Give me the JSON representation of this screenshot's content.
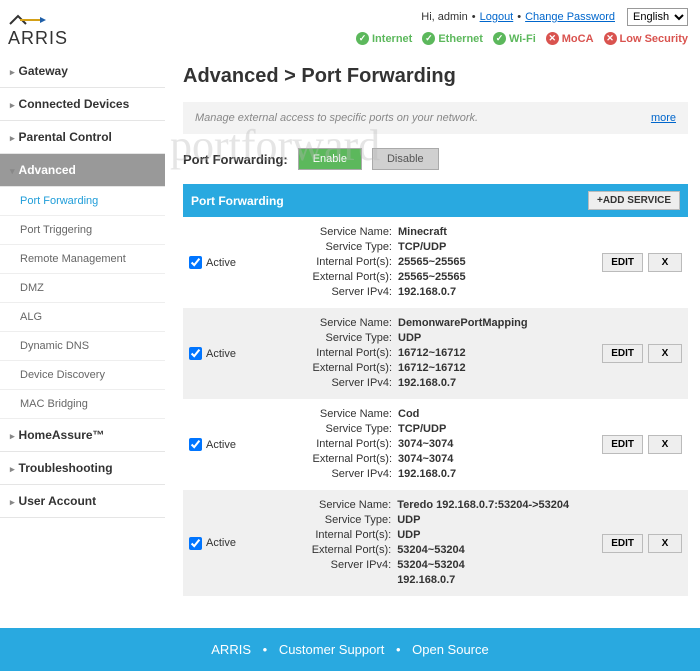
{
  "brand": "ARRIS",
  "header": {
    "greeting": "Hi, admin",
    "logout": "Logout",
    "change_pw": "Change Password",
    "lang_selected": "English"
  },
  "status": {
    "internet": {
      "label": "Internet",
      "ok": true
    },
    "ethernet": {
      "label": "Ethernet",
      "ok": true
    },
    "wifi": {
      "label": "Wi-Fi",
      "ok": true
    },
    "moca": {
      "label": "MoCA",
      "ok": false
    },
    "security": {
      "label": "Low Security",
      "ok": false
    }
  },
  "nav": {
    "gateway": "Gateway",
    "connected": "Connected Devices",
    "parental": "Parental Control",
    "advanced": "Advanced",
    "advanced_items": [
      "Port Forwarding",
      "Port Triggering",
      "Remote Management",
      "DMZ",
      "ALG",
      "Dynamic DNS",
      "Device Discovery",
      "MAC Bridging"
    ],
    "homeassure": "HomeAssure™",
    "troubleshooting": "Troubleshooting",
    "user_account": "User Account"
  },
  "page": {
    "title": "Advanced > Port Forwarding",
    "desc": "Manage external access to specific ports on your network.",
    "more": "more",
    "toggle_label": "Port Forwarding:",
    "enable": "Enable",
    "disable": "Disable",
    "panel_title": "Port Forwarding",
    "add": "+ADD SERVICE",
    "edit": "EDIT",
    "del": "X",
    "active": "Active",
    "field_labels": {
      "name": "Service Name:",
      "type": "Service Type:",
      "int": "Internal Port(s):",
      "ext": "External Port(s):",
      "ip": "Server IPv4:"
    }
  },
  "rules": [
    {
      "active": true,
      "name": "Minecraft",
      "type": "TCP/UDP",
      "int": "25565~25565",
      "ext": "25565~25565",
      "ip": "192.168.0.7"
    },
    {
      "active": true,
      "name": "DemonwarePortMapping",
      "type": "UDP",
      "int": "16712~16712",
      "ext": "16712~16712",
      "ip": "192.168.0.7"
    },
    {
      "active": true,
      "name": "Cod",
      "type": "TCP/UDP",
      "int": "3074~3074",
      "ext": "3074~3074",
      "ip": "192.168.0.7"
    },
    {
      "active": true,
      "name": "Teredo 192.168.0.7:53204->53204 UDP",
      "type": "UDP",
      "int": "53204~53204",
      "ext": "53204~53204",
      "ip": "192.168.0.7"
    }
  ],
  "footer": {
    "brand": "ARRIS",
    "support": "Customer Support",
    "open": "Open Source"
  },
  "watermark": "portforward"
}
